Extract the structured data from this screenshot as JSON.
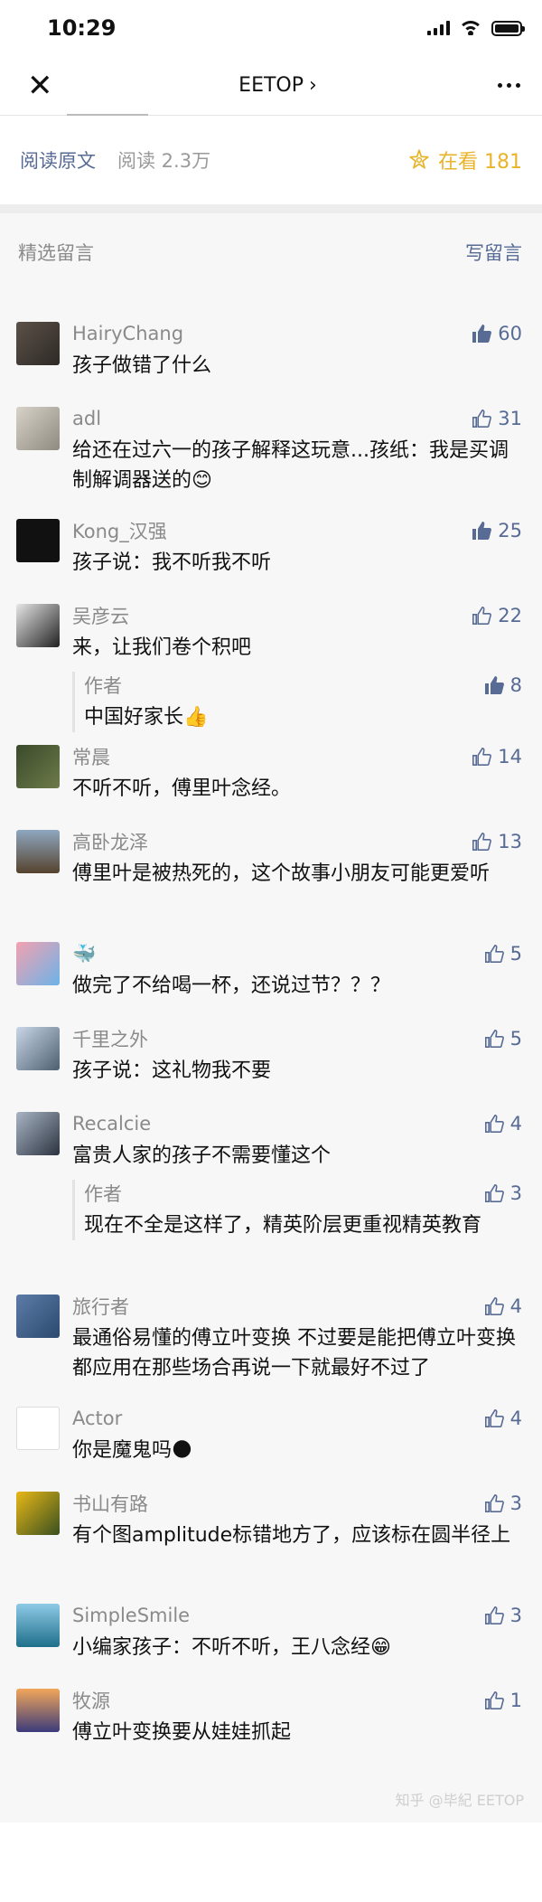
{
  "status": {
    "time": "10:29"
  },
  "nav": {
    "title": "EETOP"
  },
  "readbar": {
    "read_original": "阅读原文",
    "read_count": "阅读 2.3万",
    "looking_label": "在看 181"
  },
  "comments_header": {
    "title": "精选留言",
    "write": "写留言"
  },
  "comments": [
    {
      "name": "HairyChang",
      "likes": "60",
      "liked": true,
      "text": "孩子做错了什么"
    },
    {
      "name": "adl",
      "likes": "31",
      "liked": false,
      "text": "给还在过六一的孩子解释这玩意...孩纸：我是买调制解调器送的😊"
    },
    {
      "name": "Kong_汉强",
      "likes": "25",
      "liked": true,
      "text": "孩子说：我不听我不听"
    },
    {
      "name": "吴彦云",
      "likes": "22",
      "liked": false,
      "text": "来，让我们卷个积吧",
      "reply": {
        "name": "作者",
        "likes": "8",
        "liked": true,
        "text": "中国好家长👍"
      }
    },
    {
      "name": "常晨",
      "likes": "14",
      "liked": false,
      "text": "不听不听，傅里叶念经。"
    },
    {
      "name": "高卧龙泽",
      "likes": "13",
      "liked": false,
      "text": "傅里叶是被热死的，这个故事小朋友可能更爱听"
    },
    {
      "name": "🐳",
      "likes": "5",
      "liked": false,
      "text": "做完了不给喝一杯，还说过节？？？"
    },
    {
      "name": "千里之外",
      "likes": "5",
      "liked": false,
      "text": "孩子说：这礼物我不要"
    },
    {
      "name": "Recalcie",
      "likes": "4",
      "liked": false,
      "text": "富贵人家的孩子不需要懂这个",
      "reply": {
        "name": "作者",
        "likes": "3",
        "liked": false,
        "text": "现在不全是这样了，精英阶层更重视精英教育"
      }
    },
    {
      "name": "旅行者",
      "likes": "4",
      "liked": false,
      "text": "最通俗易懂的傅立叶变换 不过要是能把傅立叶变换都应用在那些场合再说一下就最好不过了"
    },
    {
      "name": "Actor",
      "likes": "4",
      "liked": false,
      "text": "你是魔鬼吗🌑"
    },
    {
      "name": "书山有路",
      "likes": "3",
      "liked": false,
      "text": "有个图amplitude标错地方了，应该标在圆半径上"
    },
    {
      "name": "SimpleSmile",
      "likes": "3",
      "liked": false,
      "text": "小编家孩子：不听不听，王八念经😁"
    },
    {
      "name": "牧源",
      "likes": "1",
      "liked": false,
      "text": "傅立叶变换要从娃娃抓起"
    }
  ],
  "watermark": "知乎 @毕紀 EETOP",
  "colors": {
    "link": "#576b95",
    "gold": "#e9b32a",
    "muted": "#8a8a8a"
  }
}
